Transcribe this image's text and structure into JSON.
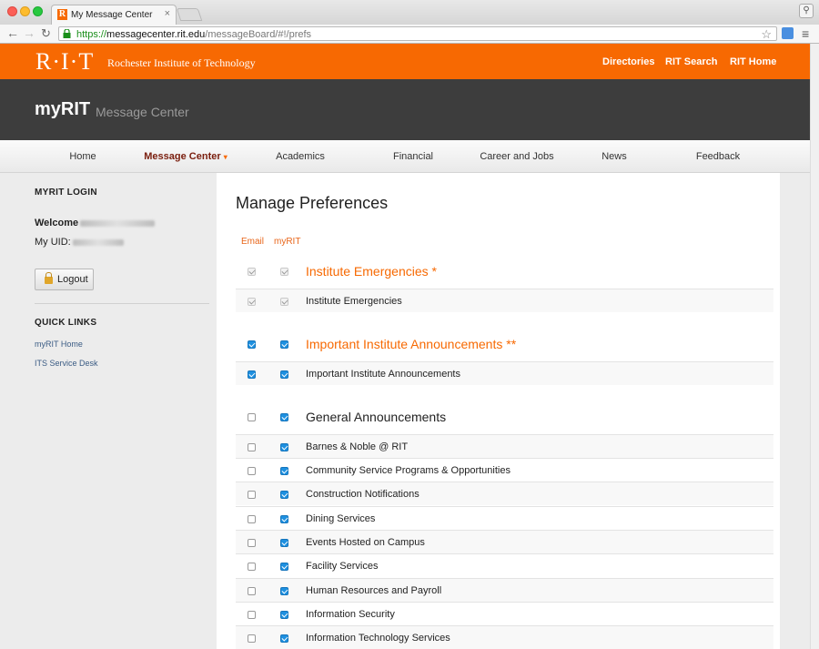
{
  "browser": {
    "tab_title": "My Message Center",
    "tab_favicon": "R",
    "tab_close": "×",
    "url_scheme": "https://",
    "url_host": "messagecenter.rit.edu",
    "url_path": "/messageBoard/#!/prefs"
  },
  "header": {
    "logo": "R·I·T",
    "institution": "Rochester Institute of Technology",
    "links": [
      "Directories",
      "RIT Search",
      "RIT Home"
    ]
  },
  "brand": {
    "title": "myRIT",
    "subtitle": "Message Center"
  },
  "nav": {
    "items": [
      "Home",
      "Message Center",
      "Academics",
      "Financial",
      "Career and Jobs",
      "News",
      "Feedback"
    ],
    "caret": "▾"
  },
  "sidebar": {
    "login_heading": "MYRIT LOGIN",
    "welcome_label": "Welcome",
    "uid_label": "My UID:",
    "logout_label": "Logout",
    "quick_links_heading": "QUICK LINKS",
    "quick_links": [
      "myRIT Home",
      "ITS Service Desk"
    ]
  },
  "content": {
    "title": "Manage Preferences",
    "col_email": "Email",
    "col_myrit": "myRIT",
    "groups": [
      {
        "label": "Institute Emergencies *",
        "email": true,
        "myrit": true,
        "locked": true
      },
      {
        "label": "Important Institute Announcements **",
        "email": true,
        "myrit": true,
        "locked": false
      },
      {
        "label": "General Announcements",
        "email": false,
        "myrit": true,
        "locked": false
      }
    ],
    "rows": [
      {
        "label": "Institute Emergencies",
        "email": true,
        "myrit": true,
        "locked": true
      },
      {
        "label": "Important Institute Announcements",
        "email": true,
        "myrit": true,
        "locked": false
      },
      {
        "label": "Barnes & Noble @ RIT",
        "email": false,
        "myrit": true
      },
      {
        "label": "Community Service Programs & Opportunities",
        "email": false,
        "myrit": true
      },
      {
        "label": "Construction Notifications",
        "email": false,
        "myrit": true
      },
      {
        "label": "Dining Services",
        "email": false,
        "myrit": true
      },
      {
        "label": "Events Hosted on Campus",
        "email": false,
        "myrit": true
      },
      {
        "label": "Facility Services",
        "email": false,
        "myrit": true
      },
      {
        "label": "Human Resources and Payroll",
        "email": false,
        "myrit": true
      },
      {
        "label": "Information Security",
        "email": false,
        "myrit": true
      },
      {
        "label": "Information Technology Services",
        "email": false,
        "myrit": true
      }
    ]
  },
  "colors": {
    "rit_orange": "#f76902",
    "dark_band": "#3d3d3d",
    "checkbox_blue": "#1e90e0",
    "active_nav": "#7a1e0e"
  }
}
